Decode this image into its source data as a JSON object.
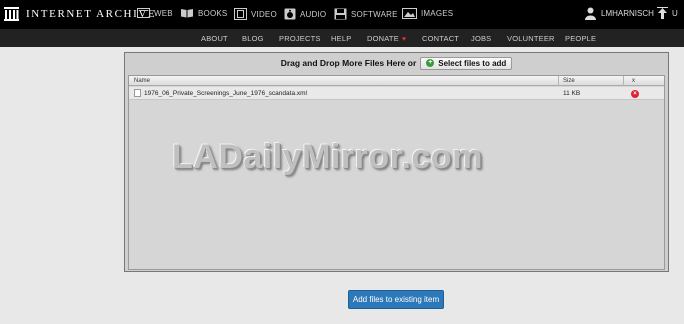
{
  "brand": {
    "logo_text": "INTERNET ARCHIVE"
  },
  "topnav": {
    "items": [
      {
        "label": "WEB",
        "icon": "web-icon"
      },
      {
        "label": "BOOKS",
        "icon": "books-icon"
      },
      {
        "label": "VIDEO",
        "icon": "video-icon"
      },
      {
        "label": "AUDIO",
        "icon": "audio-icon"
      },
      {
        "label": "SOFTWARE",
        "icon": "software-icon"
      },
      {
        "label": "IMAGES",
        "icon": "images-icon"
      }
    ],
    "user": "LMHARNISCH",
    "upload_label": "U"
  },
  "subnav": {
    "items": [
      "ABOUT",
      "BLOG",
      "PROJECTS",
      "HELP",
      "DONATE",
      "CONTACT",
      "JOBS",
      "VOLUNTEER",
      "PEOPLE"
    ]
  },
  "uploader": {
    "drop_text": "Drag and Drop More Files Here or",
    "select_button": "Select files to add",
    "columns": {
      "name": "Name",
      "size": "Size",
      "remove": "x"
    },
    "files": [
      {
        "name": "1976_06_Private_Screenings_June_1976_scandata.xml",
        "size": "11 KB"
      }
    ]
  },
  "watermark": "LADailyMirror.com",
  "add_button": "Add files to existing item",
  "colors": {
    "topbar": "#000000",
    "subbar": "#222222",
    "primary_button": "#2c78b8",
    "remove": "#dd2233"
  }
}
